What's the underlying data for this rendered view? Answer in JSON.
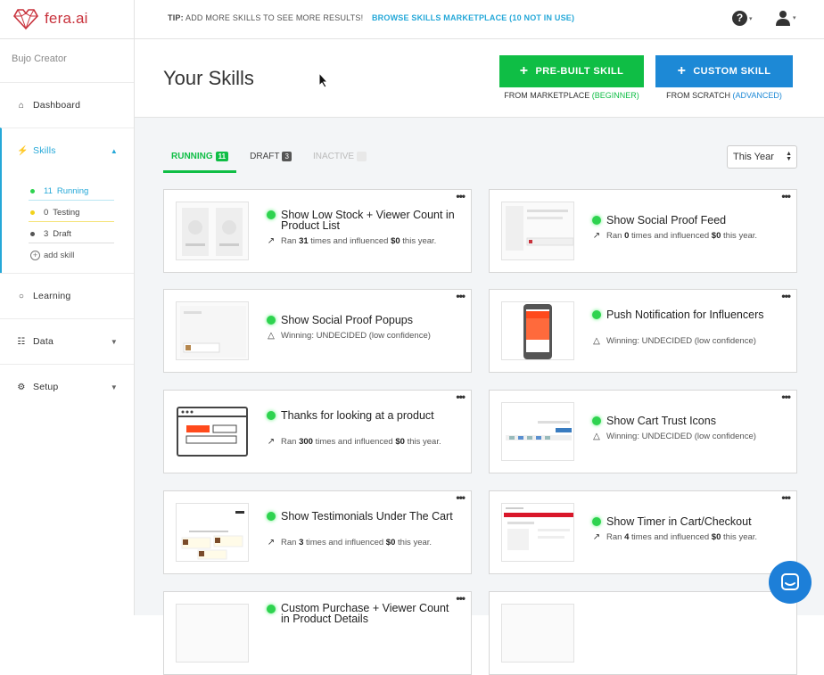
{
  "app": {
    "logo": "fera.ai"
  },
  "tip": {
    "label": "TIP:",
    "text": "ADD MORE SKILLS TO SEE MORE RESULTS!",
    "link": "BROWSE SKILLS MARKETPLACE (10 NOT IN USE)"
  },
  "header_icons": [
    "help-icon",
    "user-icon"
  ],
  "sidebar": {
    "store": "Bujo Creator",
    "items": [
      {
        "label": "Dashboard",
        "icon": "home-icon"
      },
      {
        "label": "Skills",
        "icon": "bolt-icon"
      },
      {
        "label": "Learning",
        "icon": "lightbulb-icon"
      },
      {
        "label": "Data",
        "icon": "database-icon"
      },
      {
        "label": "Setup",
        "icon": "gear-icon"
      }
    ],
    "sub": [
      {
        "count": "11",
        "label": "Running",
        "color": "#2ed34f"
      },
      {
        "count": "0",
        "label": "Testing",
        "color": "#f2d21b"
      },
      {
        "count": "3",
        "label": "Draft",
        "color": "#555555"
      },
      {
        "label": "add skill"
      }
    ]
  },
  "page": {
    "title": "Your Skills",
    "btn_prebuilt": "PRE-BUILT SKILL",
    "btn_custom": "CUSTOM SKILL",
    "prebuilt_sub": "FROM MARKETPLACE",
    "prebuilt_sub_tag": "(BEGINNER)",
    "custom_sub": "FROM SCRATCH",
    "custom_sub_tag": "(ADVANCED)"
  },
  "tabs": [
    {
      "label": "RUNNING",
      "count": "11"
    },
    {
      "label": "DRAFT",
      "count": "3"
    },
    {
      "label": "INACTIVE",
      "count": "0"
    }
  ],
  "filter": {
    "value": "This Year"
  },
  "colors": {
    "green": "#0fbe45",
    "blue": "#1d89d6",
    "accent": "#25a8d8",
    "brand": "#c8323c"
  },
  "cards": [
    {
      "title": "Show Low Stock + Viewer Count in Product List",
      "s1": "Ran",
      "n": "31",
      "s2": "times and influenced",
      "m": "$0",
      "s3": "this year."
    },
    {
      "title": "Show Social Proof Feed",
      "s1": "Ran",
      "n": "0",
      "s2": "times and influenced",
      "m": "$0",
      "s3": "this year."
    },
    {
      "title": "Show Social Proof Popups",
      "w": "Winning: UNDECIDED (low confidence)"
    },
    {
      "title": "Push Notification for Influencers",
      "w": "Winning: UNDECIDED (low confidence)"
    },
    {
      "title": "Thanks for looking at a product",
      "s1": "Ran",
      "n": "300",
      "s2": "times and influenced",
      "m": "$0",
      "s3": "this year."
    },
    {
      "title": "Show Cart Trust Icons",
      "w": "Winning: UNDECIDED (low confidence)"
    },
    {
      "title": "Show Testimonials Under The Cart",
      "s1": "Ran",
      "n": "3",
      "s2": "times and influenced",
      "m": "$0",
      "s3": "this year."
    },
    {
      "title": "Show Timer in Cart/Checkout",
      "s1": "Ran",
      "n": "4",
      "s2": "times and influenced",
      "m": "$0",
      "s3": "this year."
    },
    {
      "title": "Custom Purchase + Viewer Count in Product Details"
    },
    {
      "title": ""
    }
  ],
  "card_menu": "•••"
}
